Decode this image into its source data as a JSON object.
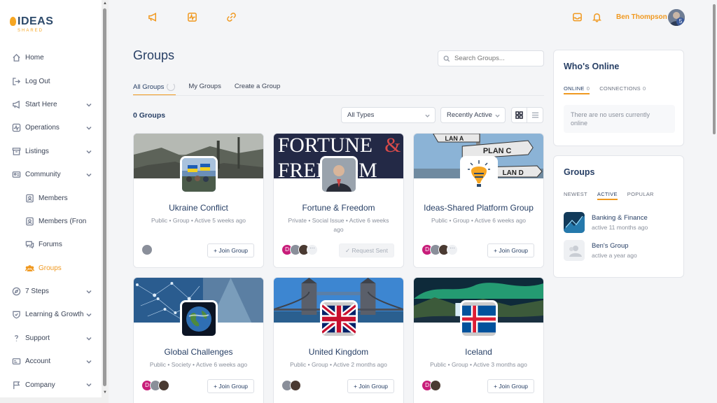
{
  "logo": {
    "text": "IDEAS",
    "sub": "SHARED"
  },
  "sidebar": {
    "items": [
      {
        "label": "Home",
        "icon": "home-icon"
      },
      {
        "label": "Log Out",
        "icon": "logout-icon"
      },
      {
        "label": "Start Here",
        "icon": "megaphone-icon"
      },
      {
        "label": "Operations",
        "icon": "activity-icon"
      },
      {
        "label": "Listings",
        "icon": "archive-icon"
      },
      {
        "label": "Community",
        "icon": "id-card-icon"
      },
      {
        "label": "Members",
        "icon": "member-icon"
      },
      {
        "label": "Members (Fron",
        "icon": "member-icon"
      },
      {
        "label": "Forums",
        "icon": "forum-icon"
      },
      {
        "label": "Groups",
        "icon": "users-icon"
      },
      {
        "label": "7 Steps",
        "icon": "compass-icon"
      },
      {
        "label": "Learning & Growth",
        "icon": "shield-icon"
      },
      {
        "label": "Support",
        "icon": "question-icon"
      },
      {
        "label": "Account",
        "icon": "card-icon"
      },
      {
        "label": "Company",
        "icon": "flag-icon"
      }
    ]
  },
  "topbar": {
    "icons": [
      "megaphone-icon",
      "activity-icon",
      "link-icon"
    ],
    "user_name": "Ben Thompson",
    "badge": "5"
  },
  "main": {
    "title": "Groups",
    "search_placeholder": "Search Groups...",
    "tabs": [
      "All Groups",
      "My Groups",
      "Create a Group"
    ],
    "count": "0 Groups",
    "filter_type": "All Types",
    "filter_order": "Recently Active"
  },
  "groups": [
    {
      "name": "Ukraine Conflict",
      "meta": "Public • Group • Active 5 weeks ago",
      "action": "+ Join Group"
    },
    {
      "name": "Fortune & Freedom",
      "meta": "Private • Social Issue • Active 6 weeks ago",
      "action": "✓ Request Sent",
      "cover_text_1": "FORTUNE",
      "cover_text_amp": "&",
      "cover_text_2": "FREEDOM"
    },
    {
      "name": "Ideas-Shared Platform Group",
      "meta": "Public • Group • Active 6 weeks ago",
      "action": "+ Join Group",
      "cover_text_1": "LAN A",
      "cover_text_2": "PLAN C",
      "cover_text_3": "LAN D"
    },
    {
      "name": "Global Challenges",
      "meta": "Public • Society • Active 6 weeks ago",
      "action": "+ Join Group"
    },
    {
      "name": "United Kingdom",
      "meta": "Public • Group • Active 2 months ago",
      "action": "+ Join Group"
    },
    {
      "name": "Iceland",
      "meta": "Public • Group • Active 3 months ago",
      "action": "+ Join Group"
    }
  ],
  "member_initial": "D",
  "more_glyph": "···",
  "whos_online": {
    "title": "Who's Online",
    "tab_online": "ONLINE",
    "online_count": "0",
    "tab_connections": "CONNECTIONS",
    "connections_count": "0",
    "empty": "There are no users currently online"
  },
  "groups_widget": {
    "title": "Groups",
    "tabs": [
      "NEWEST",
      "ACTIVE",
      "POPULAR"
    ],
    "items": [
      {
        "name": "Banking & Finance",
        "activity": "active 11 months ago"
      },
      {
        "name": "Ben's Group",
        "activity": "active a year ago"
      }
    ]
  },
  "colors": {
    "accent": "#f09920",
    "navy": "#273f65"
  }
}
